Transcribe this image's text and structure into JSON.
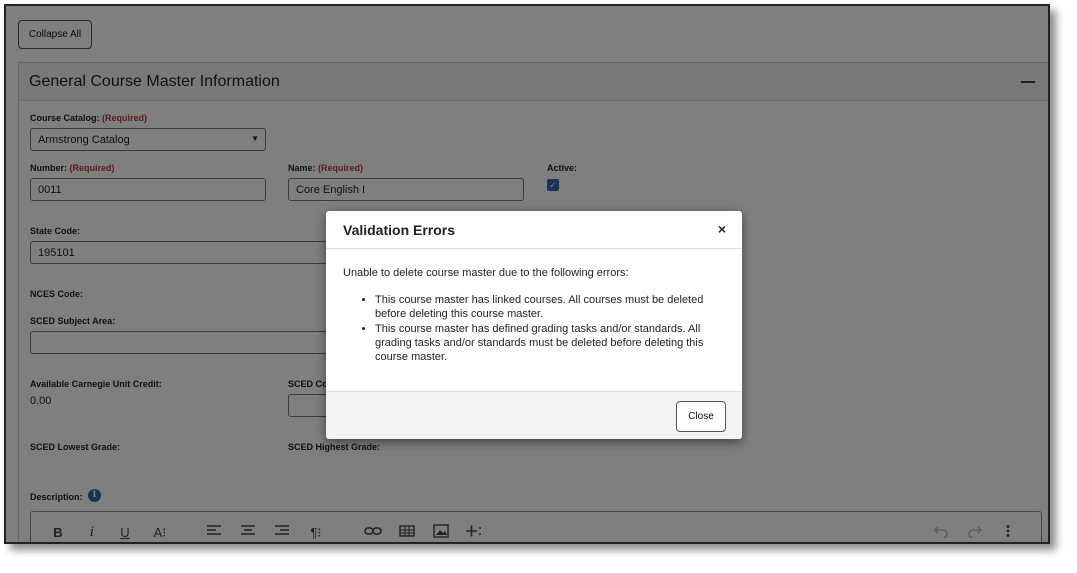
{
  "toolbar_top": {
    "collapse_all": "Collapse All"
  },
  "section": {
    "title": "General Course Master Information"
  },
  "required": "(Required)",
  "fields": {
    "course_catalog": {
      "label": "Course Catalog:",
      "value": "Armstrong Catalog"
    },
    "number": {
      "label": "Number:",
      "value": "0011"
    },
    "name": {
      "label": "Name:",
      "value": "Core English I"
    },
    "active": {
      "label": "Active:",
      "checked": true
    },
    "state_code": {
      "label": "State Code:",
      "value": "195101"
    },
    "nces_code": {
      "label": "NCES Code:"
    },
    "sced_subject_area": {
      "label": "SCED Subject Area:",
      "value": ""
    },
    "carnegie": {
      "label": "Available Carnegie Unit Credit:",
      "value": "0.00"
    },
    "sced_course": {
      "label": "SCED Co",
      "value": ""
    },
    "sced_lowest": {
      "label": "SCED Lowest Grade:"
    },
    "sced_highest": {
      "label": "SCED Highest Grade:"
    },
    "description": {
      "label": "Description:"
    }
  },
  "editor_toolbar": {
    "bold": "B",
    "italic": "i",
    "underline": "U",
    "font_size": "A⁝",
    "paragraph": "¶⁝",
    "more": "⁝"
  },
  "modal": {
    "title": "Validation Errors",
    "close_x": "×",
    "intro": "Unable to delete course master due to the following errors:",
    "errors": [
      "This course master has linked courses. All courses must be deleted before deleting this course master.",
      "This course master has defined grading tasks and/or standards. All grading tasks and/or standards must be deleted before deleting this course master."
    ],
    "close_button": "Close"
  }
}
